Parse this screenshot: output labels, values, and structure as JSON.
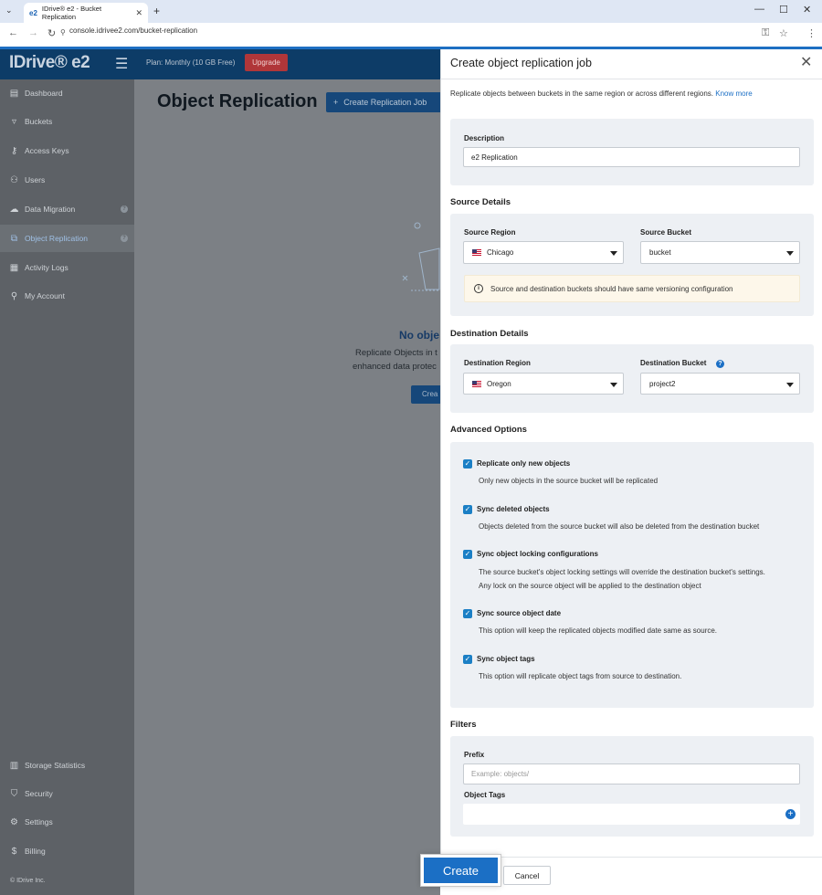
{
  "browser": {
    "tab_title": "IDrive® e2 - Bucket Replication",
    "tab_favicon": "e2",
    "url": "console.idrivee2.com/bucket-replication"
  },
  "header": {
    "logo": "IDrive® e2",
    "plan": "Plan: Monthly (10 GB Free)",
    "upgrade_label": "Upgrade"
  },
  "sidebar": {
    "items": [
      {
        "label": "Dashboard",
        "icon": "dashboard-icon"
      },
      {
        "label": "Buckets",
        "icon": "bucket-icon"
      },
      {
        "label": "Access Keys",
        "icon": "key-icon"
      },
      {
        "label": "Users",
        "icon": "users-icon"
      },
      {
        "label": "Data Migration",
        "icon": "cloud-icon"
      },
      {
        "label": "Object Replication",
        "icon": "replication-icon"
      },
      {
        "label": "Activity Logs",
        "icon": "logs-icon"
      },
      {
        "label": "My Account",
        "icon": "account-icon"
      }
    ],
    "bottom_items": [
      {
        "label": "Storage Statistics",
        "icon": "chart-icon"
      },
      {
        "label": "Security",
        "icon": "shield-icon"
      },
      {
        "label": "Settings",
        "icon": "gear-icon"
      },
      {
        "label": "Billing",
        "icon": "dollar-icon"
      }
    ],
    "copyright": "© IDrive Inc."
  },
  "main": {
    "title": "Object Replication",
    "create_job_label": "Create Replication Job",
    "empty_title": "No obje",
    "empty_desc_line1": "Replicate Objects in t",
    "empty_desc_line2": "enhanced data protec",
    "empty_button": "Crea"
  },
  "panel": {
    "title": "Create object replication job",
    "intro": "Replicate objects between buckets in the same region or across different regions.",
    "know_more": "Know more",
    "description_label": "Description",
    "description_value": "e2 Replication",
    "source_section": "Source Details",
    "source_region_label": "Source Region",
    "source_region_value": "Chicago",
    "source_bucket_label": "Source Bucket",
    "source_bucket_value": "bucket",
    "notice": "Source and destination buckets should have same versioning configuration",
    "dest_section": "Destination Details",
    "dest_region_label": "Destination Region",
    "dest_region_value": "Oregon",
    "dest_bucket_label": "Destination Bucket",
    "dest_bucket_value": "project2",
    "advanced_section": "Advanced Options",
    "options": [
      {
        "title": "Replicate only new objects",
        "desc": [
          "Only new objects in the source bucket will be replicated"
        ],
        "checked": true
      },
      {
        "title": "Sync deleted objects",
        "desc": [
          "Objects deleted from the source bucket will also be deleted from the destination bucket"
        ],
        "checked": true
      },
      {
        "title": "Sync object locking configurations",
        "desc": [
          "The source bucket's object locking settings will override the destination bucket's settings.",
          "Any lock on the source object will be applied to the destination object"
        ],
        "checked": true
      },
      {
        "title": "Sync source object date",
        "desc": [
          "This option will keep the replicated objects modified date same as source."
        ],
        "checked": true
      },
      {
        "title": "Sync object tags",
        "desc": [
          "This option will replicate object tags from source to destination."
        ],
        "checked": true
      }
    ],
    "filters_section": "Filters",
    "prefix_label": "Prefix",
    "prefix_placeholder": "Example: objects/",
    "object_tags_label": "Object Tags",
    "create_label": "Create",
    "cancel_label": "Cancel"
  }
}
